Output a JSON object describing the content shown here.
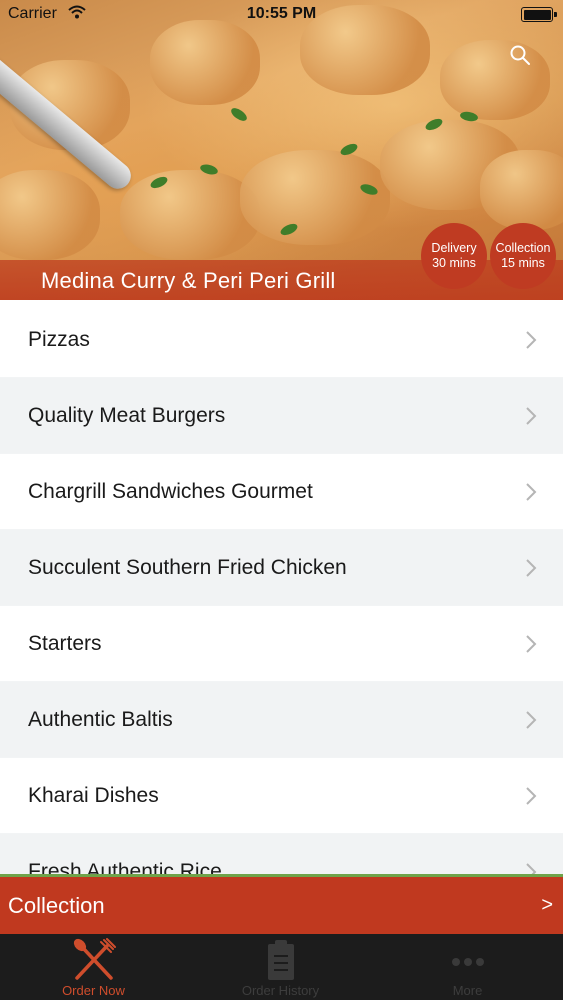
{
  "status_bar": {
    "carrier": "Carrier",
    "time": "10:55 PM",
    "battery_level": 1.0
  },
  "header": {
    "restaurant_name": "Medina Curry & Peri Peri Grill",
    "search_icon": "search-icon",
    "delivery": {
      "label": "Delivery",
      "time": "30 mins"
    },
    "collection": {
      "label": "Collection",
      "time": "15 mins"
    }
  },
  "menu": {
    "items": [
      {
        "label": "Pizzas"
      },
      {
        "label": "Quality Meat Burgers"
      },
      {
        "label": "Chargrill Sandwiches Gourmet"
      },
      {
        "label": "Succulent Southern Fried Chicken"
      },
      {
        "label": "Starters"
      },
      {
        "label": "Authentic Baltis"
      },
      {
        "label": "Kharai Dishes"
      },
      {
        "label": "Fresh Authentic Rice"
      }
    ]
  },
  "collection_bar": {
    "label": "Collection",
    "arrow": ">"
  },
  "tabbar": {
    "tabs": [
      {
        "label": "Order Now",
        "icon": "fork-knife-icon",
        "active": true
      },
      {
        "label": "Order History",
        "icon": "clipboard-icon",
        "active": false
      },
      {
        "label": "More",
        "icon": "more-dots-icon",
        "active": false
      }
    ]
  },
  "colors": {
    "accent": "#c0391f",
    "active_tab": "#cf4d2c",
    "tabbar_bg": "#1c1c1c"
  }
}
